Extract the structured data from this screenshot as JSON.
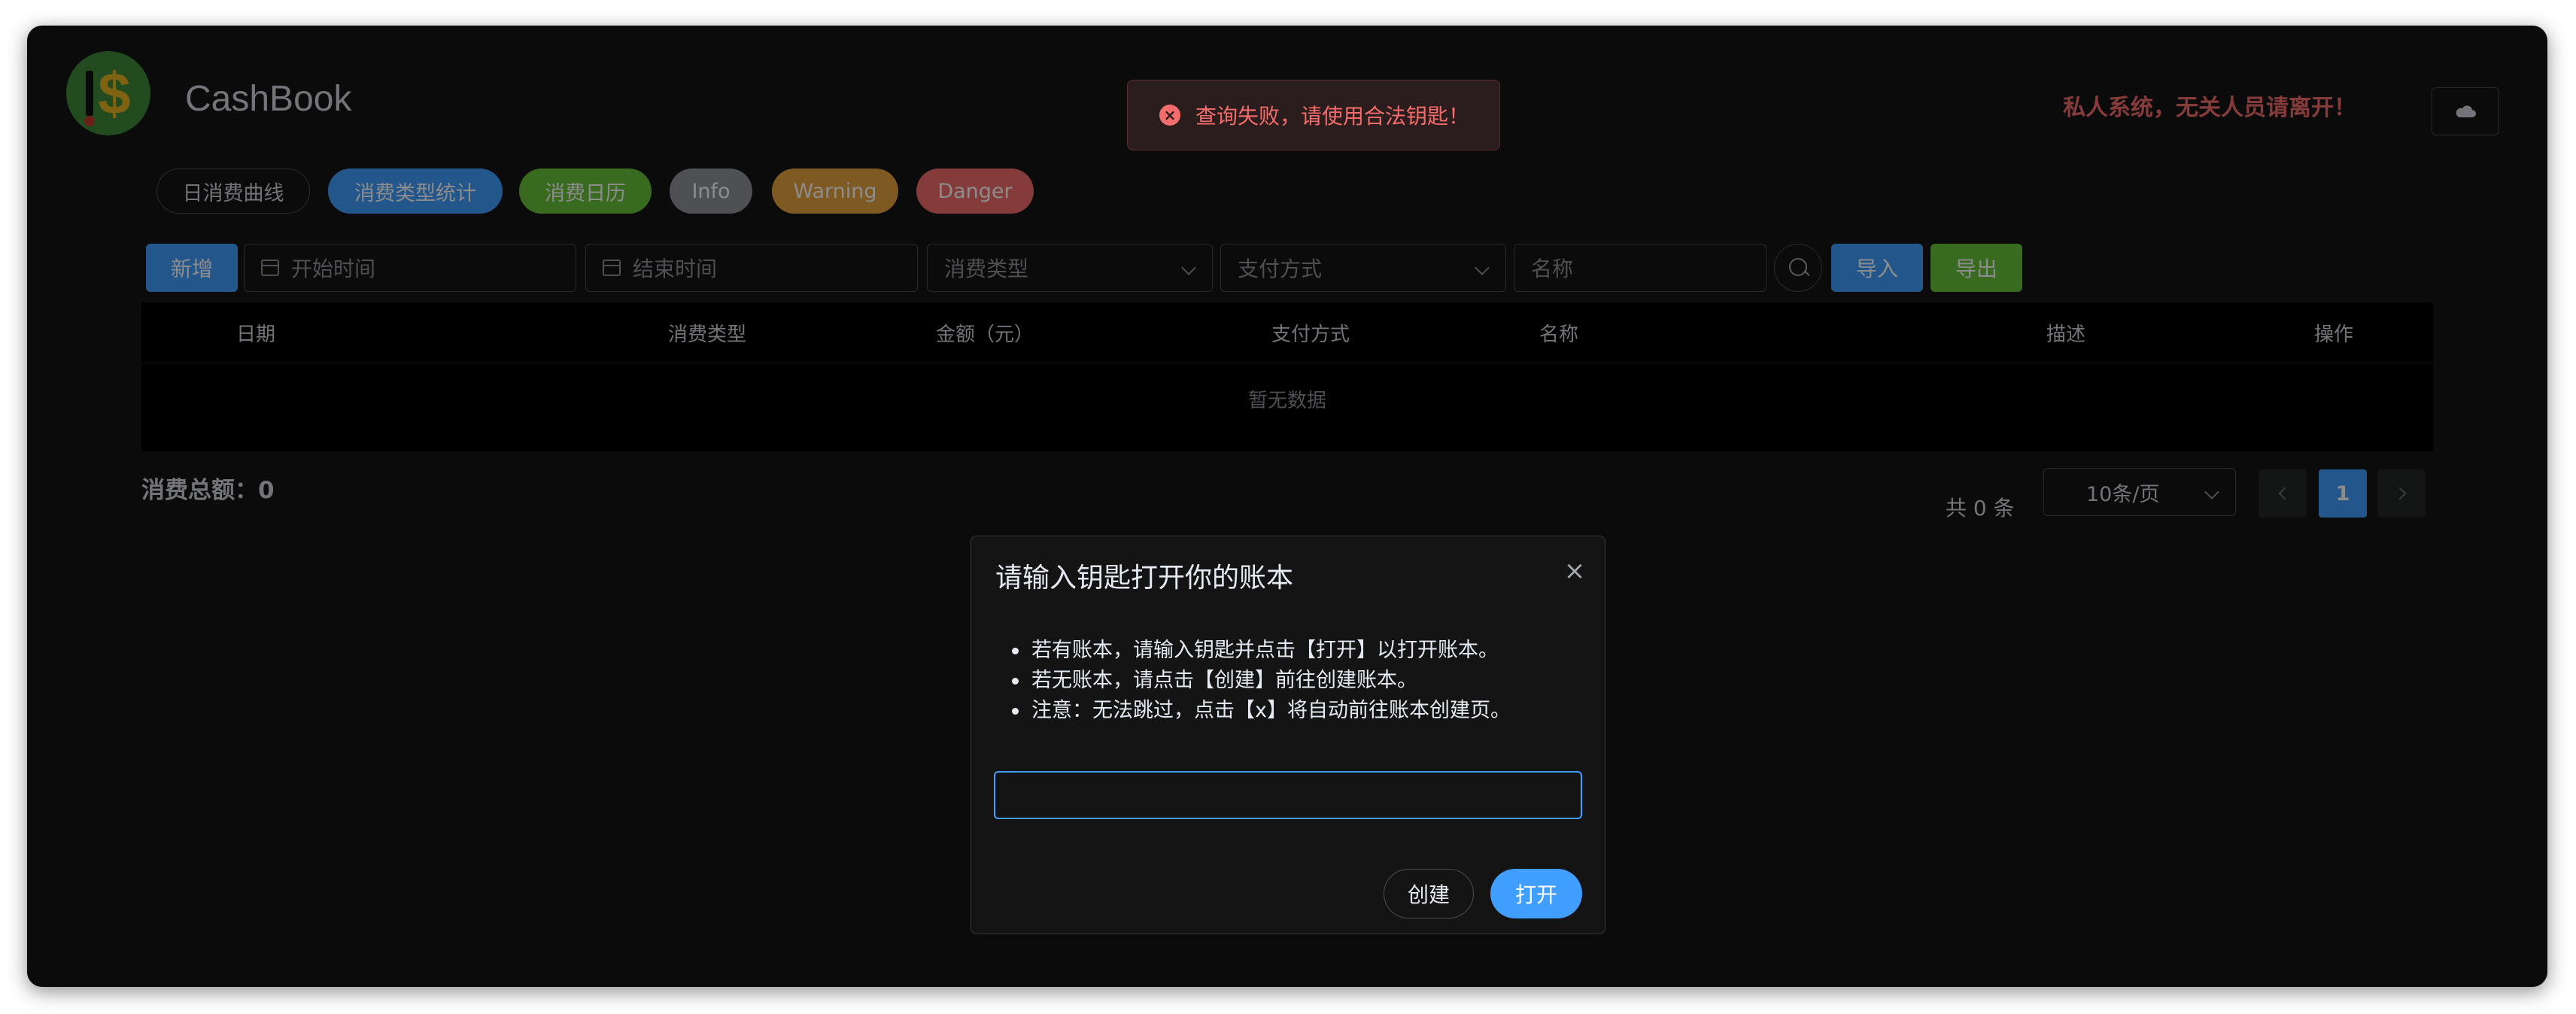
{
  "app": {
    "title": "CashBook",
    "warning": "私人系统，无关人员请离开！"
  },
  "icons": {
    "logo": "cashbook-logo-icon",
    "cloud": "cloud-icon",
    "calendar": "calendar-icon",
    "search": "search-icon",
    "close": "close-icon",
    "error": "error-circle-icon"
  },
  "colors": {
    "primary": "#409eff",
    "success": "#67c23a",
    "info": "#909399",
    "warning": "#e6a23c",
    "danger": "#f56c6c"
  },
  "tags": [
    {
      "label": "日消费曲线"
    },
    {
      "label": "消费类型统计"
    },
    {
      "label": "消费日历"
    },
    {
      "label": "Info"
    },
    {
      "label": "Warning"
    },
    {
      "label": "Danger"
    }
  ],
  "toolbar": {
    "add_label": "新增",
    "start_placeholder": "开始时间",
    "end_placeholder": "结束时间",
    "type_placeholder": "消费类型",
    "payment_placeholder": "支付方式",
    "name_placeholder": "名称",
    "import_label": "导入",
    "export_label": "导出"
  },
  "table": {
    "columns": [
      "日期",
      "消费类型",
      "金额（元）",
      "支付方式",
      "名称",
      "描述",
      "操作"
    ],
    "empty_text": "暂无数据"
  },
  "summary": {
    "total": "消费总额：0"
  },
  "pagination": {
    "total": "共 0 条",
    "page_size": "10条/页",
    "current_page": "1"
  },
  "toast": {
    "message": "查询失败，请使用合法钥匙！"
  },
  "dialog": {
    "title": "请输入钥匙打开你的账本",
    "instructions": [
      "若有账本，请输入钥匙并点击【打开】以打开账本。",
      "若无账本，请点击【创建】前往创建账本。",
      "注意：无法跳过，点击【x】将自动前往账本创建页。"
    ],
    "key_value": "",
    "create_label": "创建",
    "open_label": "打开"
  }
}
